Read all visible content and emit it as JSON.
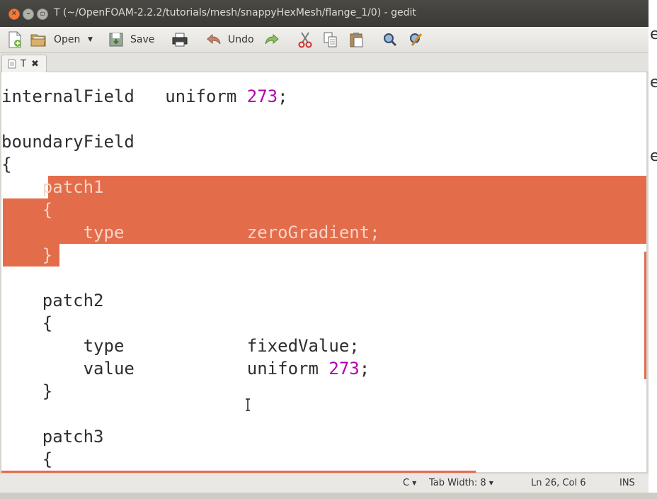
{
  "window": {
    "title": "T (~/OpenFOAM-2.2.2/tutorials/mesh/snappyHexMesh/flange_1/0) - gedit"
  },
  "toolbar": {
    "open_label": "Open",
    "save_label": "Save",
    "undo_label": "Undo"
  },
  "tab": {
    "label": "T"
  },
  "editor": {
    "l1": {
      "a": "internalField   uniform ",
      "num": "273",
      "b": ";"
    },
    "l2": "boundaryField",
    "l3": "{",
    "l4": "    patch1",
    "l5": "    {",
    "l6": "        type            zeroGradient;",
    "l7": "    }",
    "l8": "    patch2",
    "l9": "    {",
    "l10": "        type            fixedValue;",
    "l11": {
      "a": "        value           uniform ",
      "num": "273",
      "b": ";"
    },
    "l12": "    }",
    "l13": "    patch3",
    "l14": "    {"
  },
  "status": {
    "language": "C",
    "tab_width": "Tab Width: 8",
    "position": "Ln 26, Col 6",
    "mode": "INS"
  },
  "background_window": {
    "fragment1": "e",
    "fragment2": "e"
  },
  "colors": {
    "selection": "#e36c4b",
    "number": "#b000b0",
    "titlebar": "#3b3a36"
  }
}
